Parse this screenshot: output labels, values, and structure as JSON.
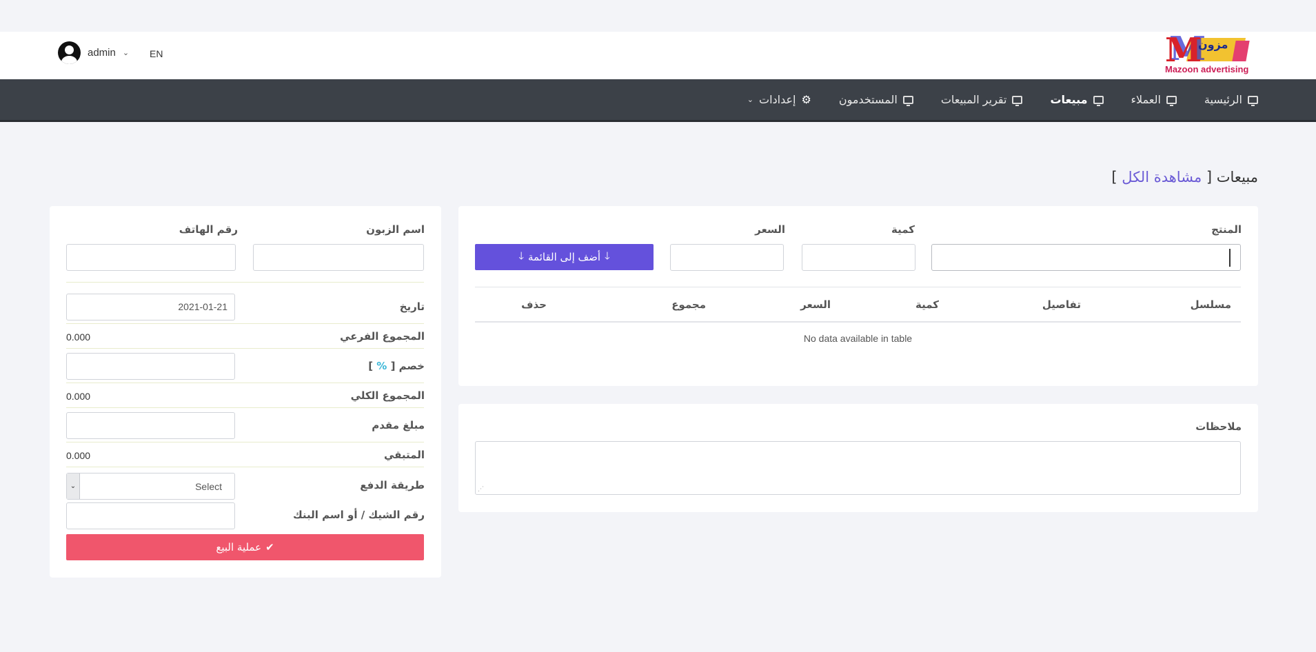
{
  "header": {
    "user_name": "admin",
    "language": "EN",
    "logo_text_ar": "مزون",
    "logo_text_en": "Mazoon advertising"
  },
  "nav": {
    "items": [
      {
        "label": "الرئيسية",
        "icon": "monitor-icon",
        "active": false
      },
      {
        "label": "العملاء",
        "icon": "monitor-icon",
        "active": false
      },
      {
        "label": "مبيعات",
        "icon": "monitor-icon",
        "active": true
      },
      {
        "label": "تقرير المبيعات",
        "icon": "monitor-icon",
        "active": false
      },
      {
        "label": "المستخدمون",
        "icon": "monitor-icon",
        "active": false
      },
      {
        "label": "إعدادات",
        "icon": "gears-icon",
        "active": false
      }
    ]
  },
  "page": {
    "title": "مبيعات",
    "view_all_link": "مشاهدة الكل",
    "bracket_open": "[",
    "bracket_close": "]"
  },
  "product_form": {
    "product_label": "المنتج",
    "quantity_label": "كمية",
    "price_label": "السعر",
    "add_button": "أضف إلى القائمة",
    "table_headers": [
      "مسلسل",
      "تفاصيل",
      "كمية",
      "السعر",
      "مجموع",
      "حذف"
    ],
    "empty_message": "No data available in table"
  },
  "notes": {
    "label": "ملاحظات"
  },
  "customer_form": {
    "customer_name_label": "اسم الزبون",
    "phone_label": "رقم الهاتف",
    "date_label": "تاريخ",
    "date_value": "2021-01-21",
    "subtotal_label": "المجموع الفرعي",
    "subtotal_value": "0.000",
    "discount_label": "خصم [",
    "discount_suffix": "]",
    "total_label": "المجموع الكلي",
    "total_value": "0.000",
    "advance_label": "مبلغ مقدم",
    "remaining_label": "المتبقي",
    "remaining_value": "0.000",
    "payment_method_label": "طريقة الدفع",
    "payment_method_selected": "Select",
    "cheque_label": "رقم الشيك / أو اسم البنك",
    "sell_button": "عملية البيع"
  },
  "colors": {
    "nav_bg": "#3c4148",
    "primary_button": "#6451dc",
    "danger_button": "#f0566c",
    "link": "#6b5bd6",
    "percent_icon": "#3bb7d8"
  }
}
